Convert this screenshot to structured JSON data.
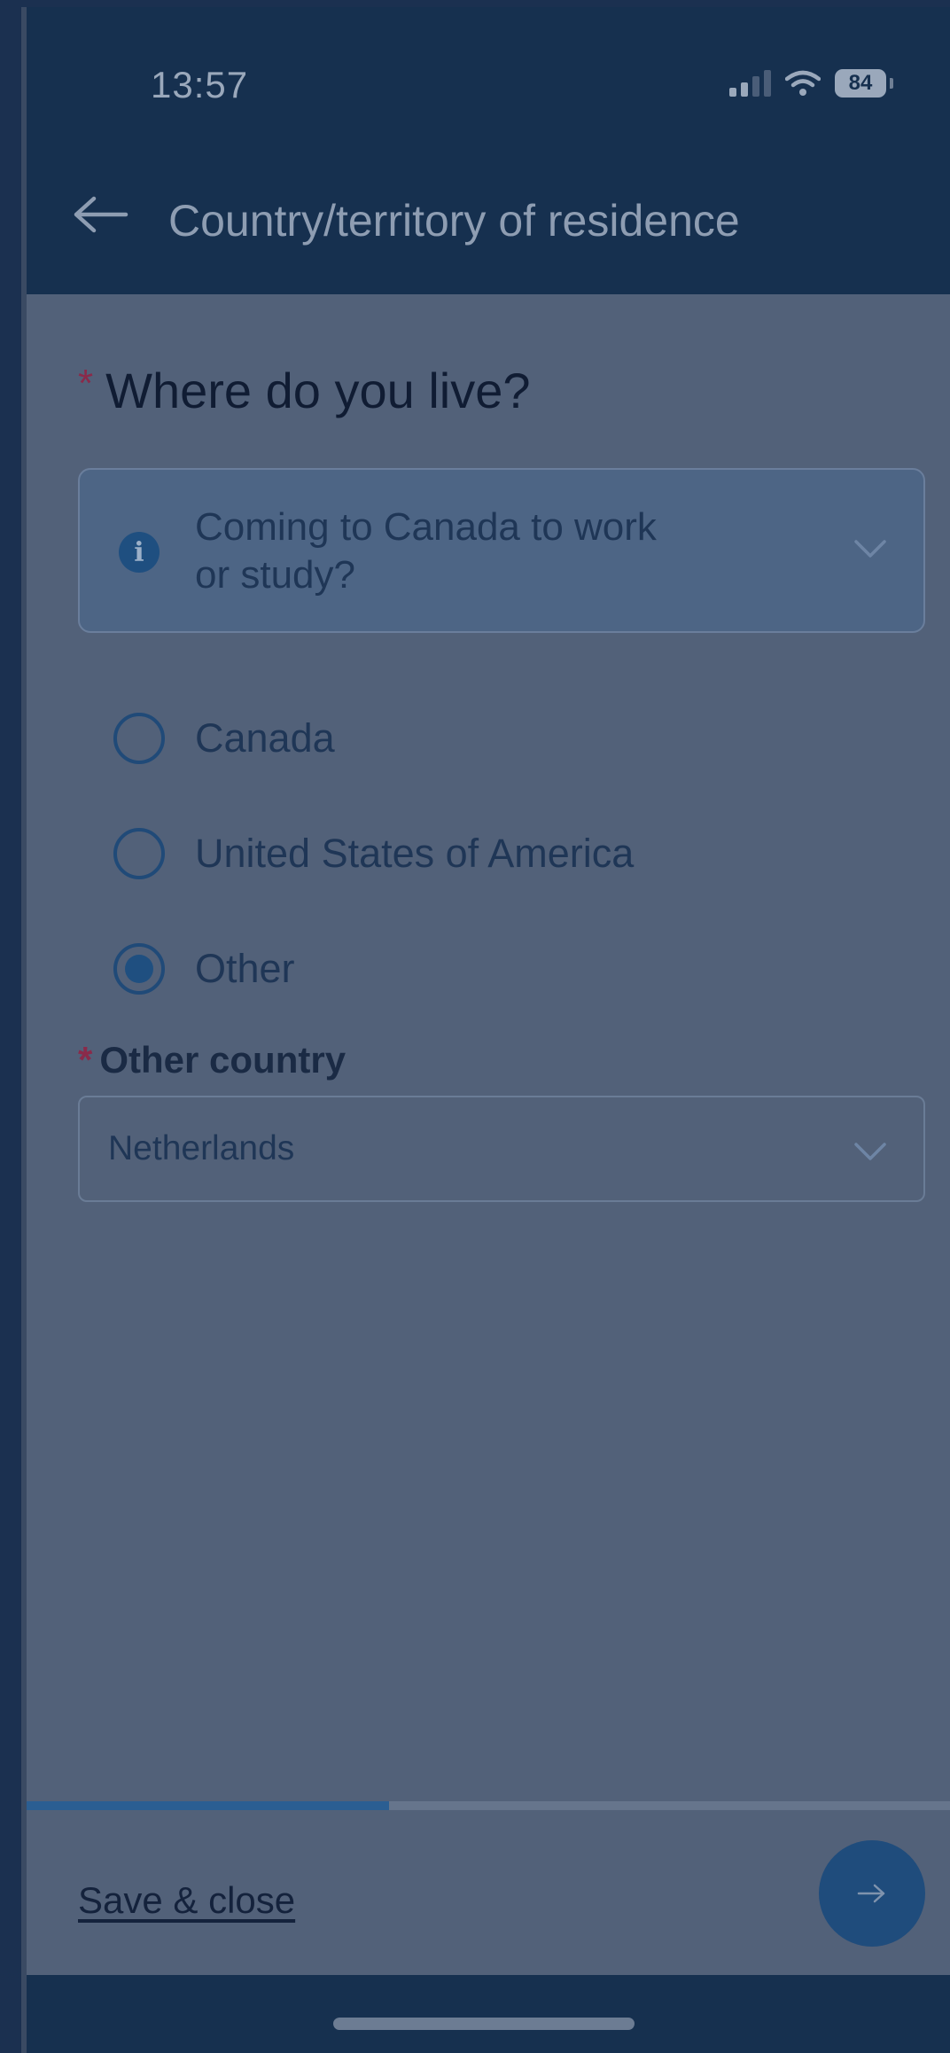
{
  "status_bar": {
    "time": "13:57",
    "battery": "84",
    "icons": [
      "signal-icon",
      "wifi-icon",
      "battery-icon"
    ]
  },
  "app_bar": {
    "back_icon": "arrow-left-icon",
    "title": "Country/territory of residence"
  },
  "form": {
    "question": {
      "required_marker": "*",
      "text": "Where do you live?"
    },
    "info_panel": {
      "icon": "info-icon",
      "icon_glyph": "i",
      "line1": "Coming to Canada to work",
      "line2": "or study?",
      "expanded": false
    },
    "options": [
      {
        "label": "Canada",
        "selected": false
      },
      {
        "label": "United States of America",
        "selected": false
      },
      {
        "label": "Other",
        "selected": true
      }
    ],
    "other_country": {
      "required_marker": "*",
      "label": "Other country",
      "value": "Netherlands"
    }
  },
  "progress": {
    "fraction": 0.39
  },
  "footer": {
    "save_label": "Save & close",
    "next_icon": "arrow-right-icon"
  },
  "colors": {
    "header_bg": "#16304f",
    "accent": "#1f4f80",
    "required": "#8a2a4a"
  }
}
